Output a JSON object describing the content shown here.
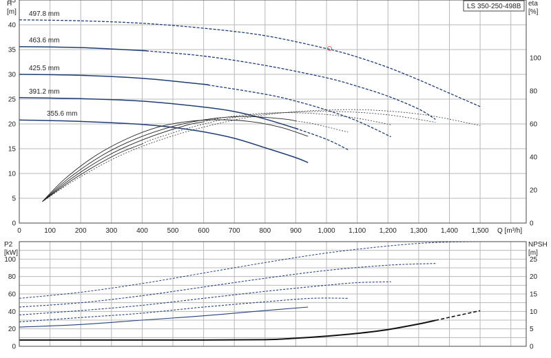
{
  "model_label": "LS 350-250-498B",
  "chart_data": [
    {
      "name": "pump-curves",
      "type": "line",
      "xlabel": "Q [m³/h]",
      "ylabel_left": "H\n[m]",
      "ylabel_right": "eta\n[%]",
      "xlim": [
        0,
        1650
      ],
      "ylim_left": [
        0,
        45
      ],
      "ylim_right": [
        0,
        135
      ],
      "grid": true,
      "x_ticks": [
        0,
        100,
        200,
        300,
        400,
        500,
        600,
        700,
        800,
        900,
        1000,
        1100,
        1200,
        1300,
        1400,
        1500
      ],
      "x_tick_labels": [
        "0",
        "100",
        "200",
        "300",
        "400",
        "500",
        "600",
        "700",
        "800",
        "900",
        "1,000",
        "1,100",
        "1,200",
        "1,300",
        "1,400",
        "1,500"
      ],
      "y_left_ticks": [
        0,
        5,
        10,
        15,
        20,
        25,
        30,
        35,
        40,
        45
      ],
      "y_right_ticks": [
        0,
        20,
        40,
        60,
        80,
        100
      ],
      "head_series": [
        {
          "name": "497.8 mm",
          "color": "#1f3d73",
          "solid_until": 0,
          "points": [
            [
              0,
              41.0
            ],
            [
              200,
              40.8
            ],
            [
              400,
              40.3
            ],
            [
              600,
              39.3
            ],
            [
              800,
              37.8
            ],
            [
              1000,
              35.2
            ],
            [
              1100,
              33.5
            ],
            [
              1200,
              31.4
            ],
            [
              1300,
              28.9
            ],
            [
              1400,
              26.2
            ],
            [
              1500,
              23.5
            ]
          ]
        },
        {
          "name": "463.6 mm",
          "color": "#1f3d73",
          "solid_until": 400,
          "points": [
            [
              0,
              35.6
            ],
            [
              200,
              35.4
            ],
            [
              400,
              34.8
            ],
            [
              600,
              33.7
            ],
            [
              800,
              31.8
            ],
            [
              1000,
              29.3
            ],
            [
              1100,
              27.6
            ],
            [
              1200,
              25.6
            ],
            [
              1300,
              23.0
            ],
            [
              1355,
              20.9
            ]
          ]
        },
        {
          "name": "425.5 mm",
          "color": "#1f3d73",
          "solid_until": 600,
          "points": [
            [
              0,
              30.0
            ],
            [
              200,
              29.8
            ],
            [
              400,
              29.2
            ],
            [
              600,
              28.0
            ],
            [
              800,
              26.0
            ],
            [
              900,
              24.6
            ],
            [
              1000,
              22.8
            ],
            [
              1100,
              20.6
            ],
            [
              1210,
              17.4
            ]
          ]
        },
        {
          "name": "391.2 mm",
          "color": "#1f3d73",
          "solid_until": 900,
          "points": [
            [
              0,
              25.3
            ],
            [
              200,
              25.1
            ],
            [
              400,
              24.6
            ],
            [
              600,
              23.4
            ],
            [
              700,
              22.5
            ],
            [
              800,
              21.0
            ],
            [
              900,
              19.1
            ],
            [
              1000,
              16.9
            ],
            [
              1070,
              14.8
            ]
          ]
        },
        {
          "name": "355.6 mm",
          "color": "#1f3d73",
          "solid_until": 940,
          "points": [
            [
              0,
              20.8
            ],
            [
              200,
              20.5
            ],
            [
              400,
              19.9
            ],
            [
              500,
              19.3
            ],
            [
              600,
              18.4
            ],
            [
              700,
              17.1
            ],
            [
              800,
              15.2
            ],
            [
              900,
              13.2
            ],
            [
              940,
              12.2
            ]
          ]
        }
      ],
      "efficiency_series": [
        {
          "name": "eta 355.6",
          "solid_until": 940,
          "points": [
            [
              75,
              13
            ],
            [
              150,
              27
            ],
            [
              250,
              41
            ],
            [
              350,
              51
            ],
            [
              450,
              58
            ],
            [
              550,
              61.5
            ],
            [
              650,
              62.5
            ],
            [
              750,
              61.5
            ],
            [
              850,
              58
            ],
            [
              940,
              52.5
            ]
          ]
        },
        {
          "name": "eta 391.2",
          "solid_until": 900,
          "points": [
            [
              75,
              13
            ],
            [
              160,
              27
            ],
            [
              270,
              41
            ],
            [
              380,
              51
            ],
            [
              500,
              58.5
            ],
            [
              620,
              63
            ],
            [
              740,
              64.5
            ],
            [
              860,
              63
            ],
            [
              960,
              60
            ],
            [
              1070,
              55
            ]
          ]
        },
        {
          "name": "eta 425.5",
          "solid_until": 600,
          "points": [
            [
              75,
              13
            ],
            [
              170,
              27
            ],
            [
              290,
              41
            ],
            [
              410,
              51
            ],
            [
              540,
              59
            ],
            [
              670,
              64
            ],
            [
              800,
              66.5
            ],
            [
              940,
              66.5
            ],
            [
              1080,
              64
            ],
            [
              1210,
              59.5
            ]
          ]
        },
        {
          "name": "eta 463.6",
          "solid_until": 400,
          "points": [
            [
              75,
              13
            ],
            [
              180,
              27
            ],
            [
              310,
              41
            ],
            [
              440,
              51
            ],
            [
              580,
              59
            ],
            [
              720,
              64.5
            ],
            [
              880,
              67
            ],
            [
              1040,
              67.5
            ],
            [
              1200,
              65.5
            ],
            [
              1355,
              61
            ]
          ]
        },
        {
          "name": "eta 497.8",
          "solid_until": 0,
          "points": [
            [
              75,
              13
            ],
            [
              190,
              27
            ],
            [
              330,
              41
            ],
            [
              470,
              51
            ],
            [
              620,
              59
            ],
            [
              780,
              65
            ],
            [
              950,
              68
            ],
            [
              1130,
              68.5
            ],
            [
              1320,
              65.5
            ],
            [
              1500,
              59
            ]
          ]
        }
      ],
      "duty_point": {
        "q": 1010,
        "h": 35.2,
        "color": "#e05a5a"
      }
    },
    {
      "name": "power-npsh",
      "type": "line",
      "ylabel_left": "P2\n[kW]",
      "ylabel_right": "NPSH\n[m]",
      "xlim": [
        0,
        1650
      ],
      "ylim_left": [
        0,
        120
      ],
      "ylim_right": [
        0,
        30
      ],
      "grid": true,
      "y_left_ticks": [
        0,
        20,
        40,
        60,
        80,
        100
      ],
      "y_right_ticks": [
        0,
        5,
        10,
        15,
        20,
        25
      ],
      "power_series": [
        {
          "name": "P2 497.8",
          "points": [
            [
              0,
              55
            ],
            [
              200,
              62
            ],
            [
              400,
              72
            ],
            [
              600,
              84
            ],
            [
              800,
              96
            ],
            [
              1000,
              107
            ],
            [
              1200,
              115
            ],
            [
              1350,
              119
            ],
            [
              1500,
              120
            ]
          ]
        },
        {
          "name": "P2 463.6",
          "points": [
            [
              0,
              45
            ],
            [
              200,
              50
            ],
            [
              400,
              58
            ],
            [
              600,
              68
            ],
            [
              800,
              78
            ],
            [
              1000,
              87
            ],
            [
              1200,
              93
            ],
            [
              1355,
              95
            ]
          ]
        },
        {
          "name": "P2 425.5",
          "points": [
            [
              0,
              36
            ],
            [
              200,
              41
            ],
            [
              400,
              47
            ],
            [
              600,
              55
            ],
            [
              800,
              63
            ],
            [
              1000,
              70
            ],
            [
              1100,
              73
            ],
            [
              1210,
              74
            ]
          ]
        },
        {
          "name": "P2 391.2",
          "points": [
            [
              0,
              28
            ],
            [
              200,
              33
            ],
            [
              400,
              38
            ],
            [
              600,
              45
            ],
            [
              800,
              51
            ],
            [
              950,
              55
            ],
            [
              1070,
              55
            ]
          ]
        },
        {
          "name": "P2 355.6",
          "points": [
            [
              0,
              22
            ],
            [
              200,
              25
            ],
            [
              400,
              30
            ],
            [
              600,
              35
            ],
            [
              800,
              41
            ],
            [
              940,
              45
            ]
          ]
        }
      ],
      "npsh_series": {
        "name": "NPSH",
        "solid_until": 1355,
        "points": [
          [
            0,
            1.8
          ],
          [
            300,
            1.8
          ],
          [
            600,
            1.8
          ],
          [
            800,
            1.9
          ],
          [
            900,
            2.3
          ],
          [
            1000,
            2.9
          ],
          [
            1100,
            3.7
          ],
          [
            1200,
            4.8
          ],
          [
            1300,
            6.4
          ],
          [
            1400,
            8.3
          ],
          [
            1500,
            10.2
          ]
        ]
      }
    }
  ]
}
